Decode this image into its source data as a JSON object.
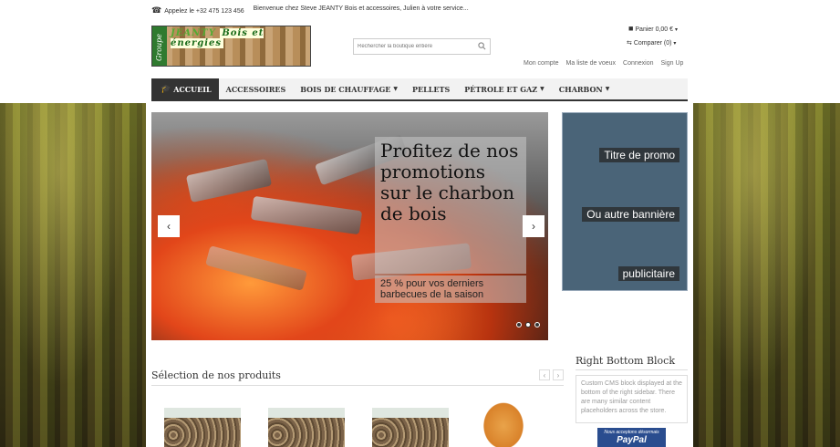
{
  "topbar": {
    "phone_icon": "phone-icon",
    "phone": "Appelez le +32 475 123 456",
    "welcome": "Bienvenue chez Steve JEANTY Bois et accessoires, Julien à votre service..."
  },
  "logo": {
    "side_text": "Groupe",
    "title_part1": "JEANTY",
    "title_part2": "Bois et énergies"
  },
  "search": {
    "placeholder": "Rechercher la boutique entière"
  },
  "cart": {
    "label": "Panier 0,00 €"
  },
  "compare": {
    "label": "Comparer (0)"
  },
  "user_links": [
    "Mon compte",
    "Ma liste de voeux",
    "Connexion",
    "Sign Up"
  ],
  "nav": {
    "items": [
      {
        "label": "ACCUEIL",
        "active": true
      },
      {
        "label": "ACCESSOIRES"
      },
      {
        "label": "BOIS DE CHAUFFAGE",
        "dropdown": true
      },
      {
        "label": "PELLETS"
      },
      {
        "label": "PÉTROLE ET GAZ",
        "dropdown": true
      },
      {
        "label": "CHARBON",
        "dropdown": true
      }
    ]
  },
  "slider": {
    "caption": "Profitez de nos promotions sur le charbon de bois",
    "subcaption": "25 % pour vos derniers barbecues de la saison",
    "prev": "‹",
    "next": "›",
    "slide_count": 3,
    "active_slide": 2
  },
  "promo": {
    "labels": [
      "Titre de promo",
      "Ou autre bannière",
      "publicitaire"
    ]
  },
  "products": {
    "title": "Sélection de nos produits",
    "prev": "‹",
    "next": "›"
  },
  "right_block": {
    "title": "Right Bottom Block",
    "text": "Custom CMS block displayed at the bottom of the right sidebar. There are many similar content placeholders across the store.",
    "paypal_small": "Nous acceptons désormais",
    "paypal_brand": "PayPal"
  }
}
